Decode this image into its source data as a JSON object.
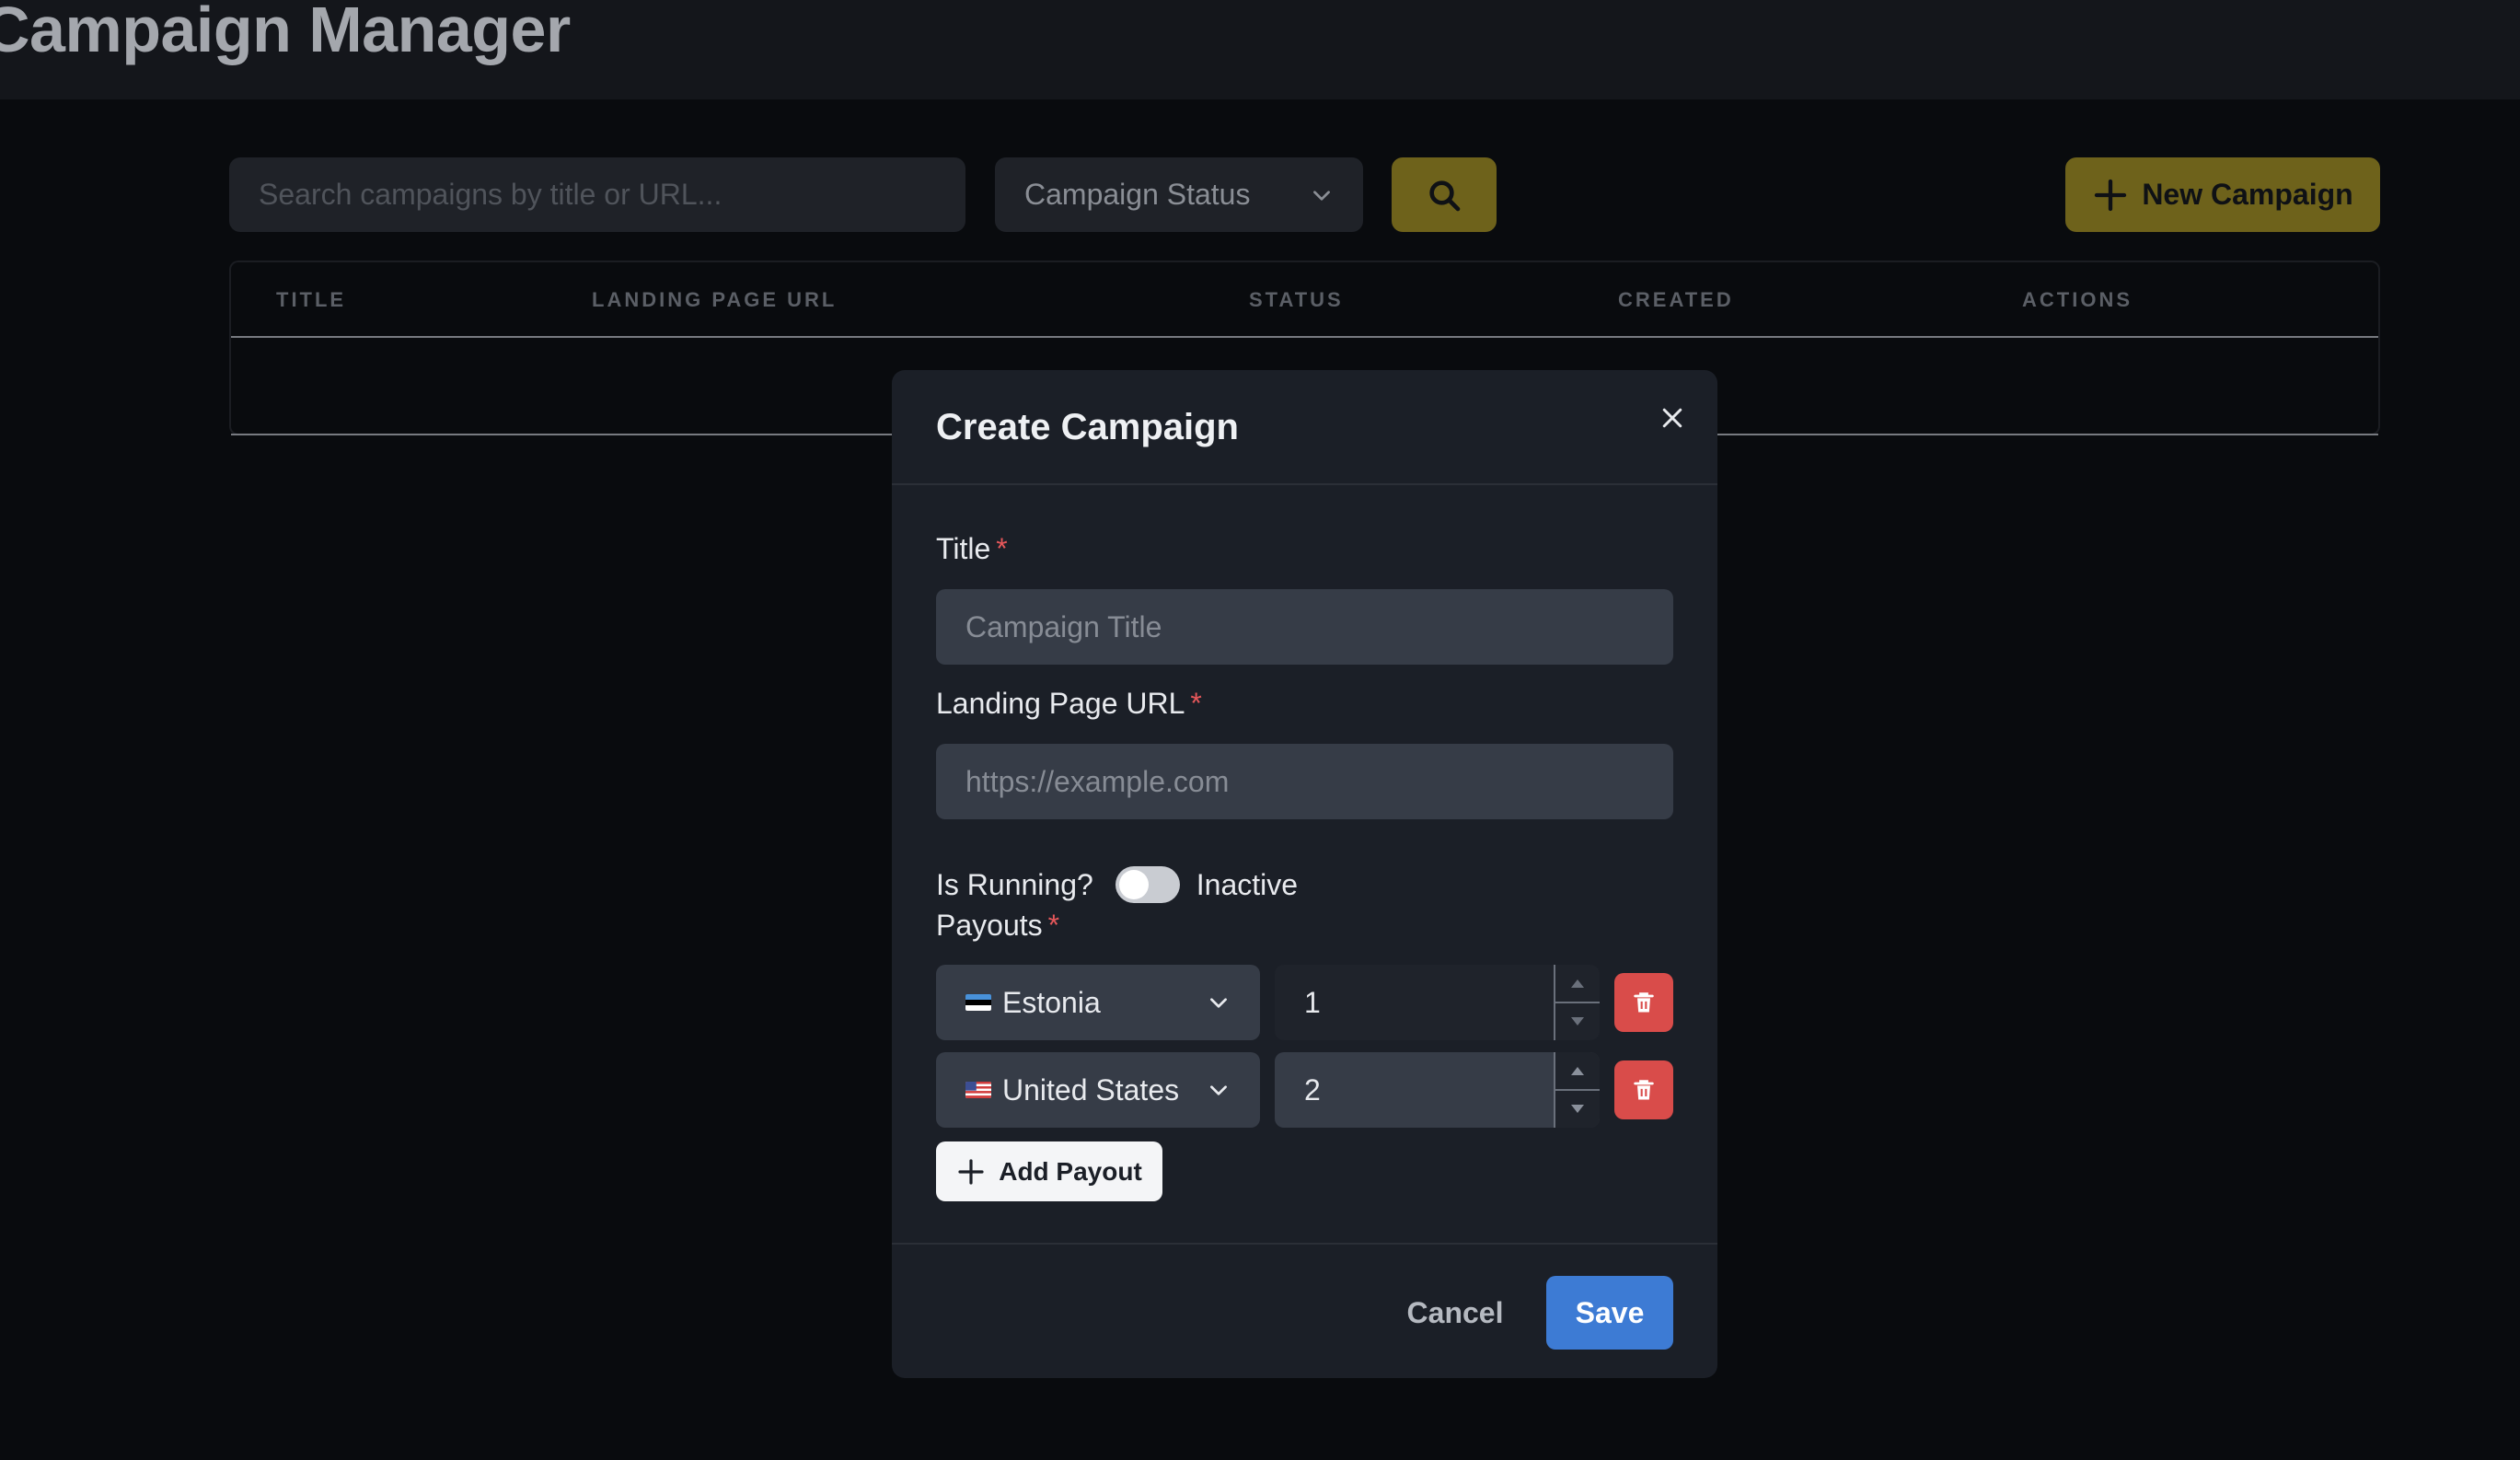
{
  "app": {
    "title": "Campaign Manager"
  },
  "toolbar": {
    "search_placeholder": "Search campaigns by title or URL...",
    "status_filter": "Campaign Status",
    "new_campaign": "New Campaign"
  },
  "table": {
    "columns": [
      "TITLE",
      "LANDING PAGE URL",
      "STATUS",
      "CREATED",
      "ACTIONS"
    ]
  },
  "modal": {
    "title": "Create Campaign",
    "title_label": "Title",
    "title_placeholder": "Campaign Title",
    "url_label": "Landing Page URL",
    "url_placeholder": "https://example.com",
    "required_marker": "*",
    "running_label": "Is Running?",
    "running_state": "Inactive",
    "running_on": false,
    "payouts_label": "Payouts",
    "payouts": [
      {
        "country": "Estonia",
        "amount": "1"
      },
      {
        "country": "United States",
        "amount": "2"
      }
    ],
    "add_payout": "Add Payout",
    "cancel": "Cancel",
    "save": "Save"
  },
  "colors": {
    "accent": "#6e621b",
    "primary": "#3d7bd4",
    "danger": "#d94c4a",
    "required": "#e5575a"
  },
  "icons": [
    "search-icon",
    "plus-icon",
    "chevron-down-icon",
    "close-icon",
    "trash-icon",
    "flag-icon"
  ]
}
